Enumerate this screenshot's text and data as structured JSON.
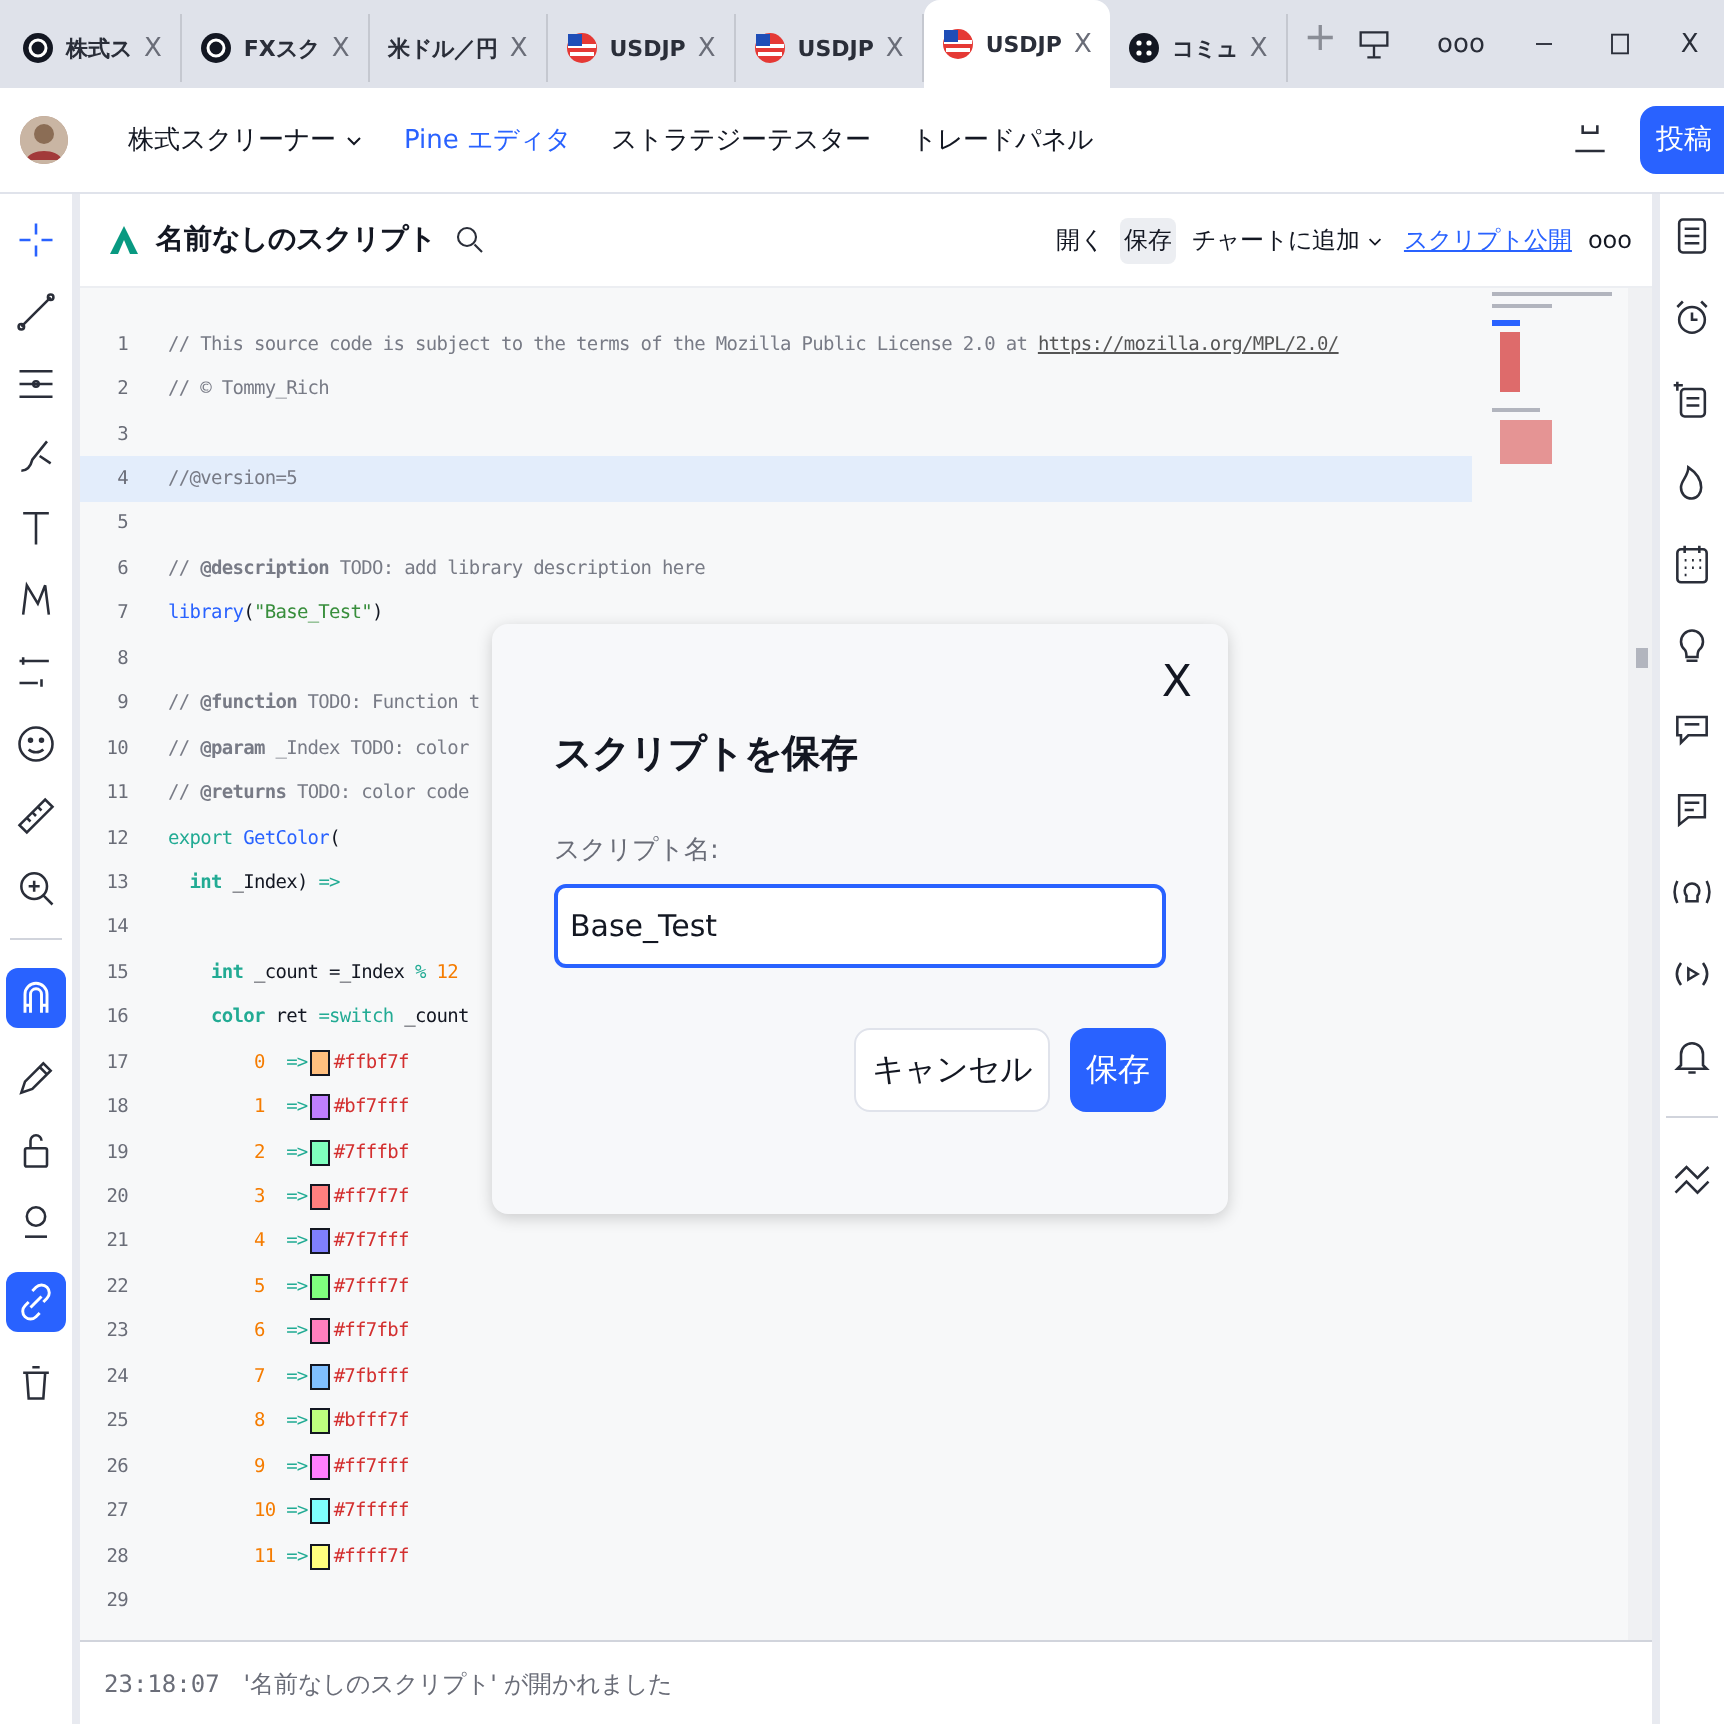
{
  "browser_tabs": [
    {
      "kind": "logo",
      "label": "株式ス",
      "close": "X",
      "selected": false
    },
    {
      "kind": "logo",
      "label": "FXスク",
      "close": "X",
      "selected": false
    },
    {
      "label": "米ドル／円",
      "close": "X",
      "selected": false
    },
    {
      "kind": "flag",
      "label": "USDJP",
      "close": "X",
      "selected": false
    },
    {
      "kind": "flag",
      "label": "USDJP",
      "close": "X",
      "selected": false
    },
    {
      "kind": "flag",
      "label": "USDJP",
      "close": "X",
      "selected": true
    },
    {
      "kind": "community",
      "label": "コミュ",
      "close": "X",
      "selected": false
    }
  ],
  "new_tab": "+",
  "window_controls": {
    "more": "ooo",
    "close": "X"
  },
  "nav": {
    "items": [
      {
        "label": "株式スクリーナー",
        "dropdown": true,
        "selected": false
      },
      {
        "label": "Pine エディタ",
        "dropdown": false,
        "selected": true
      },
      {
        "label": "ストラテジーテスター",
        "dropdown": false,
        "selected": false
      },
      {
        "label": "トレードパネル",
        "dropdown": false,
        "selected": false
      }
    ],
    "post_button": "投稿"
  },
  "editor": {
    "title": "名前なしのスクリプト",
    "actions": [
      {
        "label": "開く",
        "kind": "plain"
      },
      {
        "label": "保存",
        "kind": "pressed"
      },
      {
        "label": "チャートに追加",
        "kind": "dropdown"
      },
      {
        "label": "スクリプト公開",
        "kind": "link"
      }
    ],
    "more": "ooo",
    "lines": [
      {
        "number": "1",
        "current": false,
        "tokens": [
          {
            "kind": "comment",
            "text": "// This source code is subject to the terms of the Mozilla Public License 2.0 at "
          },
          {
            "kind": "link",
            "text": "https://mozilla.org/MPL/2.0/"
          }
        ]
      },
      {
        "number": "2",
        "current": false,
        "tokens": [
          {
            "kind": "comment",
            "text": "// © Tommy_Rich"
          }
        ]
      },
      {
        "number": "3",
        "current": false
      },
      {
        "number": "4",
        "current": true,
        "tokens": [
          {
            "kind": "comment",
            "text": "//@version=5"
          }
        ]
      },
      {
        "number": "5",
        "current": false
      },
      {
        "number": "6",
        "current": false,
        "tokens": [
          {
            "kind": "comment",
            "text": "// "
          },
          {
            "kind": "tag",
            "text": "@description"
          },
          {
            "kind": "comment",
            "text": " TODO: add library description here"
          }
        ]
      },
      {
        "number": "7",
        "current": false,
        "tokens": [
          {
            "kind": "func",
            "text": "library"
          },
          {
            "kind": "plain",
            "text": "("
          },
          {
            "kind": "string",
            "text": "\"Base_Test\""
          },
          {
            "kind": "plain",
            "text": ")"
          }
        ]
      },
      {
        "number": "8",
        "current": false
      },
      {
        "number": "9",
        "current": false,
        "tokens": [
          {
            "kind": "comment",
            "text": "// "
          },
          {
            "kind": "tag",
            "text": "@function"
          },
          {
            "kind": "comment",
            "text": " TODO: Function t"
          }
        ]
      },
      {
        "number": "10",
        "current": false,
        "tokens": [
          {
            "kind": "comment",
            "text": "// "
          },
          {
            "kind": "tag",
            "text": "@param"
          },
          {
            "kind": "comment",
            "text": " _Index TODO: color"
          }
        ]
      },
      {
        "number": "11",
        "current": false,
        "tokens": [
          {
            "kind": "comment",
            "text": "// "
          },
          {
            "kind": "tag",
            "text": "@returns"
          },
          {
            "kind": "comment",
            "text": " TODO: color code"
          }
        ]
      },
      {
        "number": "12",
        "current": false,
        "tokens": [
          {
            "kind": "keyword",
            "text": "export "
          },
          {
            "kind": "func",
            "text": "GetColor"
          },
          {
            "kind": "plain",
            "text": "("
          }
        ]
      },
      {
        "number": "13",
        "current": false,
        "tokens": [
          {
            "kind": "type",
            "text": "  int"
          },
          {
            "kind": "plain",
            "text": " _Index) "
          },
          {
            "kind": "keyword",
            "text": "=>"
          }
        ]
      },
      {
        "number": "14",
        "current": false
      },
      {
        "number": "15",
        "current": false,
        "tokens": [
          {
            "kind": "type",
            "text": "    int"
          },
          {
            "kind": "plain",
            "text": " _count =_Index "
          },
          {
            "kind": "keyword",
            "text": "%"
          },
          {
            "kind": "number",
            "text": " 12"
          }
        ]
      },
      {
        "number": "16",
        "current": false,
        "tokens": [
          {
            "kind": "type",
            "text": "    color"
          },
          {
            "kind": "plain",
            "text": " ret "
          },
          {
            "kind": "keyword",
            "text": "=switch"
          },
          {
            "kind": "plain",
            "text": " _count"
          }
        ]
      },
      {
        "number": "17",
        "current": false,
        "tokens": [
          {
            "kind": "number",
            "text": "        0"
          },
          {
            "kind": "keyword",
            "text": "  =>"
          },
          {
            "kind": "swatch",
            "color": "#ffbf7f"
          },
          {
            "kind": "hex",
            "text": "#ffbf7f"
          }
        ]
      },
      {
        "number": "18",
        "current": false,
        "tokens": [
          {
            "kind": "number",
            "text": "        1"
          },
          {
            "kind": "keyword",
            "text": "  =>"
          },
          {
            "kind": "swatch",
            "color": "#bf7fff"
          },
          {
            "kind": "hex",
            "text": "#bf7fff"
          }
        ]
      },
      {
        "number": "19",
        "current": false,
        "tokens": [
          {
            "kind": "number",
            "text": "        2"
          },
          {
            "kind": "keyword",
            "text": "  =>"
          },
          {
            "kind": "swatch",
            "color": "#7fffbf"
          },
          {
            "kind": "hex",
            "text": "#7fffbf"
          }
        ]
      },
      {
        "number": "20",
        "current": false,
        "tokens": [
          {
            "kind": "number",
            "text": "        3"
          },
          {
            "kind": "keyword",
            "text": "  =>"
          },
          {
            "kind": "swatch",
            "color": "#ff7f7f"
          },
          {
            "kind": "hex",
            "text": "#ff7f7f"
          }
        ]
      },
      {
        "number": "21",
        "current": false,
        "tokens": [
          {
            "kind": "number",
            "text": "        4"
          },
          {
            "kind": "keyword",
            "text": "  =>"
          },
          {
            "kind": "swatch",
            "color": "#7f7fff"
          },
          {
            "kind": "hex",
            "text": "#7f7fff"
          }
        ]
      },
      {
        "number": "22",
        "current": false,
        "tokens": [
          {
            "kind": "number",
            "text": "        5"
          },
          {
            "kind": "keyword",
            "text": "  =>"
          },
          {
            "kind": "swatch",
            "color": "#7fff7f"
          },
          {
            "kind": "hex",
            "text": "#7fff7f"
          }
        ]
      },
      {
        "number": "23",
        "current": false,
        "tokens": [
          {
            "kind": "number",
            "text": "        6"
          },
          {
            "kind": "keyword",
            "text": "  =>"
          },
          {
            "kind": "swatch",
            "color": "#ff7fbf"
          },
          {
            "kind": "hex",
            "text": "#ff7fbf"
          }
        ]
      },
      {
        "number": "24",
        "current": false,
        "tokens": [
          {
            "kind": "number",
            "text": "        7"
          },
          {
            "kind": "keyword",
            "text": "  =>"
          },
          {
            "kind": "swatch",
            "color": "#7fbfff"
          },
          {
            "kind": "hex",
            "text": "#7fbfff"
          }
        ]
      },
      {
        "number": "25",
        "current": false,
        "tokens": [
          {
            "kind": "number",
            "text": "        8"
          },
          {
            "kind": "keyword",
            "text": "  =>"
          },
          {
            "kind": "swatch",
            "color": "#bfff7f"
          },
          {
            "kind": "hex",
            "text": "#bfff7f"
          }
        ]
      },
      {
        "number": "26",
        "current": false,
        "tokens": [
          {
            "kind": "number",
            "text": "        9"
          },
          {
            "kind": "keyword",
            "text": "  =>"
          },
          {
            "kind": "swatch",
            "color": "#ff7fff"
          },
          {
            "kind": "hex",
            "text": "#ff7fff"
          }
        ]
      },
      {
        "number": "27",
        "current": false,
        "tokens": [
          {
            "kind": "number",
            "text": "        10"
          },
          {
            "kind": "keyword",
            "text": " =>"
          },
          {
            "kind": "swatch",
            "color": "#7fffff"
          },
          {
            "kind": "hex",
            "text": "#7fffff"
          }
        ]
      },
      {
        "number": "28",
        "current": false,
        "tokens": [
          {
            "kind": "number",
            "text": "        11"
          },
          {
            "kind": "keyword",
            "text": " =>"
          },
          {
            "kind": "swatch",
            "color": "#ffff7f"
          },
          {
            "kind": "hex",
            "text": "#ffff7f"
          }
        ]
      },
      {
        "number": "29",
        "current": false
      }
    ],
    "log": {
      "time": "23:18:07",
      "message": "'名前なしのスクリプト' が開かれました"
    }
  },
  "dialog": {
    "title": "スクリプトを保存",
    "close": "X",
    "field_label": "スクリプト名:",
    "value": "Base_Test",
    "buttons": [
      {
        "label": "キャンセル",
        "kind": "secondary"
      },
      {
        "label": "保存",
        "kind": "primary"
      }
    ]
  }
}
